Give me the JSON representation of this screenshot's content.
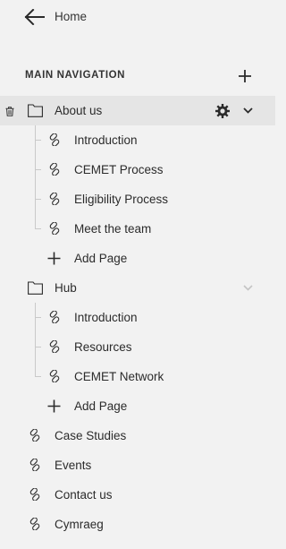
{
  "header": {
    "back_label": "Home"
  },
  "section": {
    "title": "MAIN NAVIGATION"
  },
  "tree": {
    "about": {
      "label": "About us",
      "children": [
        "Introduction",
        "CEMET Process",
        "Eligibility Process",
        "Meet the team"
      ],
      "add_label": "Add Page"
    },
    "hub": {
      "label": "Hub",
      "children": [
        "Introduction",
        "Resources",
        "CEMET Network"
      ],
      "add_label": "Add Page"
    },
    "links": [
      "Case Studies",
      "Events",
      "Contact us",
      "Cymraeg"
    ]
  },
  "icons": {
    "back": "arrow-left-icon",
    "add": "plus-icon",
    "delete": "trash-icon",
    "folder": "folder-icon",
    "settings": "gear-icon",
    "expand": "chevron-down-icon",
    "link": "link-icon"
  },
  "colors": {
    "background": "#f2f2f2",
    "selected_row": "#e5e5e5",
    "text": "#2b2b2b",
    "muted_chevron": "#c4c4c4"
  }
}
